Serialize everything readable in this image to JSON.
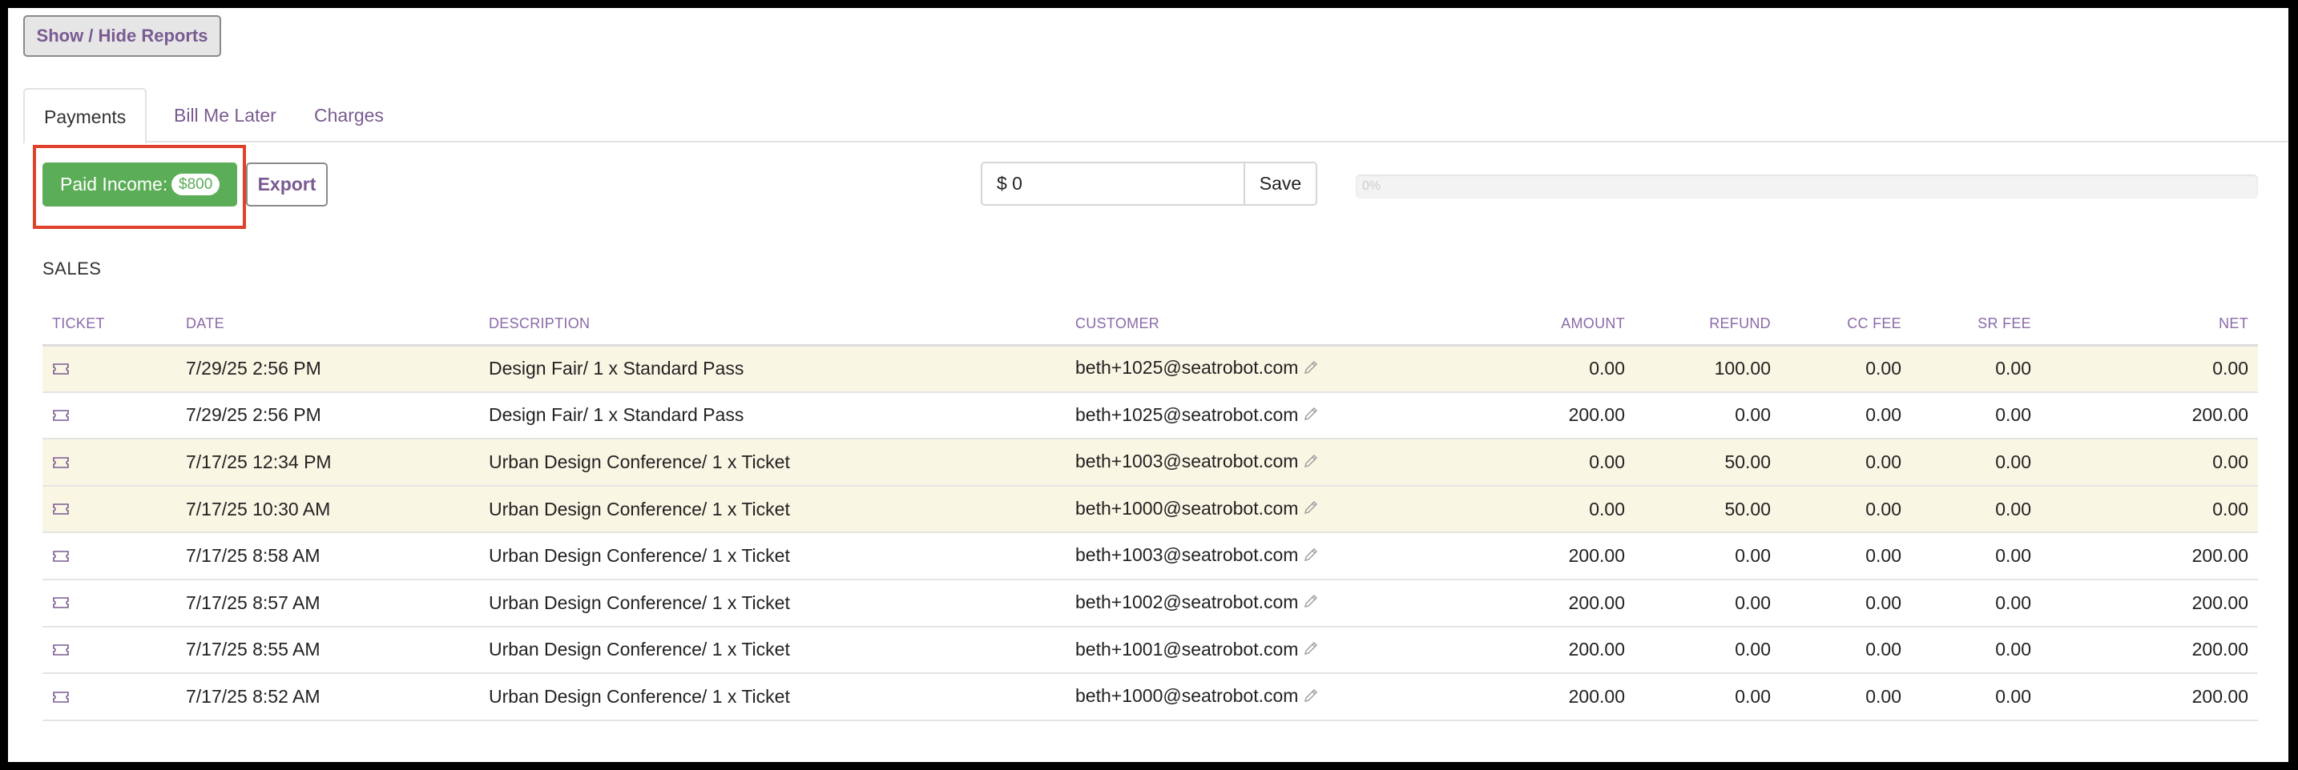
{
  "toolbar": {
    "show_hide_label": "Show / Hide Reports"
  },
  "tabs": [
    {
      "label": "Payments",
      "active": true
    },
    {
      "label": "Bill Me Later",
      "active": false
    },
    {
      "label": "Charges",
      "active": false
    }
  ],
  "actions": {
    "paid_income_label": "Paid Income:",
    "paid_income_value": "$800",
    "export_label": "Export",
    "amount_input_value": "$ 0",
    "save_label": "Save",
    "progress_text": "0%",
    "progress_value": 0
  },
  "sales": {
    "title": "SALES",
    "columns": [
      "TICKET",
      "DATE",
      "DESCRIPTION",
      "CUSTOMER",
      "AMOUNT",
      "REFUND",
      "CC FEE",
      "SR FEE",
      "NET"
    ],
    "rows": [
      {
        "date": "7/29/25 2:56 PM",
        "description": "Design Fair/ 1 x Standard Pass",
        "customer": "beth+1025@seatrobot.com",
        "amount": "0.00",
        "refund": "100.00",
        "cc_fee": "0.00",
        "sr_fee": "0.00",
        "net": "0.00",
        "highlight": true
      },
      {
        "date": "7/29/25 2:56 PM",
        "description": "Design Fair/ 1 x Standard Pass",
        "customer": "beth+1025@seatrobot.com",
        "amount": "200.00",
        "refund": "0.00",
        "cc_fee": "0.00",
        "sr_fee": "0.00",
        "net": "200.00",
        "highlight": false
      },
      {
        "date": "7/17/25 12:34 PM",
        "description": "Urban Design Conference/ 1 x Ticket",
        "customer": "beth+1003@seatrobot.com",
        "amount": "0.00",
        "refund": "50.00",
        "cc_fee": "0.00",
        "sr_fee": "0.00",
        "net": "0.00",
        "highlight": true
      },
      {
        "date": "7/17/25 10:30 AM",
        "description": "Urban Design Conference/ 1 x Ticket",
        "customer": "beth+1000@seatrobot.com",
        "amount": "0.00",
        "refund": "50.00",
        "cc_fee": "0.00",
        "sr_fee": "0.00",
        "net": "0.00",
        "highlight": true
      },
      {
        "date": "7/17/25 8:58 AM",
        "description": "Urban Design Conference/ 1 x Ticket",
        "customer": "beth+1003@seatrobot.com",
        "amount": "200.00",
        "refund": "0.00",
        "cc_fee": "0.00",
        "sr_fee": "0.00",
        "net": "200.00",
        "highlight": false
      },
      {
        "date": "7/17/25 8:57 AM",
        "description": "Urban Design Conference/ 1 x Ticket",
        "customer": "beth+1002@seatrobot.com",
        "amount": "200.00",
        "refund": "0.00",
        "cc_fee": "0.00",
        "sr_fee": "0.00",
        "net": "200.00",
        "highlight": false
      },
      {
        "date": "7/17/25 8:55 AM",
        "description": "Urban Design Conference/ 1 x Ticket",
        "customer": "beth+1001@seatrobot.com",
        "amount": "200.00",
        "refund": "0.00",
        "cc_fee": "0.00",
        "sr_fee": "0.00",
        "net": "200.00",
        "highlight": false
      },
      {
        "date": "7/17/25 8:52 AM",
        "description": "Urban Design Conference/ 1 x Ticket",
        "customer": "beth+1000@seatrobot.com",
        "amount": "200.00",
        "refund": "0.00",
        "cc_fee": "0.00",
        "sr_fee": "0.00",
        "net": "200.00",
        "highlight": false
      }
    ]
  },
  "colors": {
    "accent_purple": "#7a5a92",
    "success_green": "#5cad58",
    "highlight_row": "#faf6e4",
    "annotation_red": "#e0412b"
  },
  "icons": {
    "ticket": "ticket-icon",
    "edit": "pencil-icon"
  }
}
